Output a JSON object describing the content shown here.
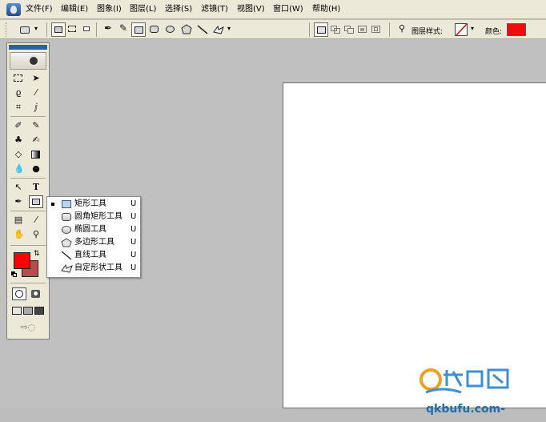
{
  "menubar": {
    "items": [
      {
        "label": "文件(F)"
      },
      {
        "label": "编辑(E)"
      },
      {
        "label": "图象(I)"
      },
      {
        "label": "图层(L)"
      },
      {
        "label": "选择(S)"
      },
      {
        "label": "滤镜(T)"
      },
      {
        "label": "视图(V)"
      },
      {
        "label": "窗口(W)"
      },
      {
        "label": "帮助(H)"
      }
    ]
  },
  "options_bar": {
    "layer_style_label": "图层样式:",
    "color_label": "颜色:",
    "color_value": "#ee0d0d"
  },
  "toolbox": {
    "foreground_color": "#ff0000",
    "background_color": "#b44d4d"
  },
  "flyout": {
    "items": [
      {
        "label": "矩形工具",
        "key": "U",
        "icon": "rectangle-tool-icon",
        "selected": true
      },
      {
        "label": "圆角矩形工具",
        "key": "U",
        "icon": "rounded-rectangle-tool-icon",
        "selected": false
      },
      {
        "label": "椭圆工具",
        "key": "U",
        "icon": "ellipse-tool-icon",
        "selected": false
      },
      {
        "label": "多边形工具",
        "key": "U",
        "icon": "polygon-tool-icon",
        "selected": false
      },
      {
        "label": "直线工具",
        "key": "U",
        "icon": "line-tool-icon",
        "selected": false
      },
      {
        "label": "自定形状工具",
        "key": "U",
        "icon": "custom-shape-tool-icon",
        "selected": false
      }
    ]
  },
  "watermark": {
    "url": "qkbufu.com-"
  }
}
